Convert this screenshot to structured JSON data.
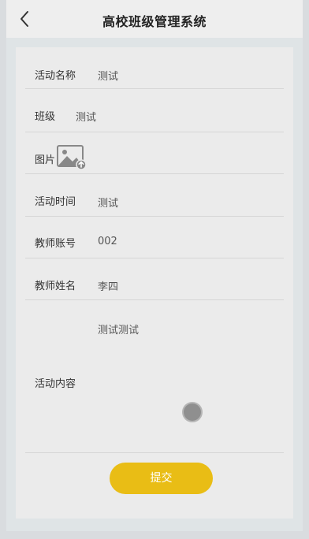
{
  "header": {
    "title": "高校班级管理系统",
    "back_icon": "chevron-left-icon"
  },
  "form": {
    "activity_name": {
      "label": "活动名称",
      "value": "测试"
    },
    "class": {
      "label": "班级",
      "value": "测试"
    },
    "image": {
      "label": "图片",
      "icon": "image-upload-icon"
    },
    "activity_time": {
      "label": "活动时间",
      "value": "测试"
    },
    "teacher_account": {
      "label": "教师账号",
      "value": "002"
    },
    "teacher_name": {
      "label": "教师姓名",
      "value": "李四"
    },
    "activity_content": {
      "label": "活动内容",
      "value": "测试测试"
    }
  },
  "actions": {
    "submit_label": "提交"
  },
  "colors": {
    "accent": "#e9bd15",
    "header_bg": "#eeeeee",
    "card_bg": "#ebebeb"
  }
}
